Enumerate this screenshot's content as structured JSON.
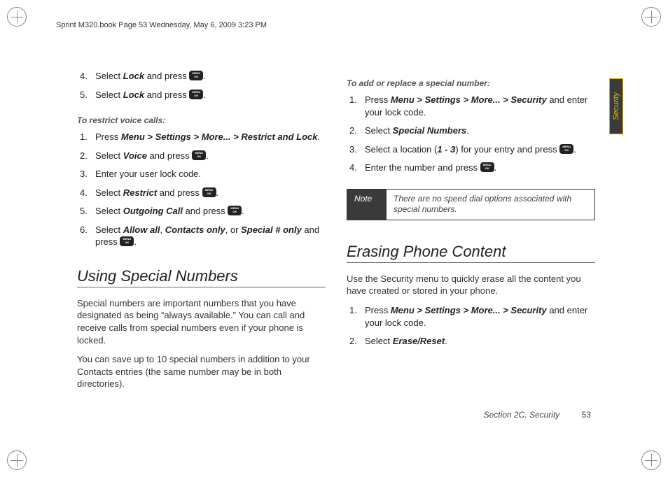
{
  "header": "Sprint M320.book  Page 53  Wednesday, May 6, 2009  3:23 PM",
  "tab_label": "Security",
  "col1": {
    "steps_top": [
      {
        "pre": "Select ",
        "b": "Lock",
        "post": " and press "
      },
      {
        "pre": "Select ",
        "b": "Lock",
        "post": " and press "
      }
    ],
    "sub1": "To restrict voice calls:",
    "steps_restrict": [
      {
        "full_bold_path": true,
        "pre": "Press ",
        "b": "Menu > Settings > More... > Restrict and Lock",
        "post": "."
      },
      {
        "pre": "Select ",
        "b": "Voice",
        "post": " and press "
      },
      {
        "plain": "Enter your user lock code."
      },
      {
        "pre": "Select ",
        "b": "Restrict",
        "post": " and press "
      },
      {
        "pre": "Select ",
        "b": "Outgoing Call",
        "post": " and press "
      },
      {
        "multi": true,
        "pre": "Select ",
        "b1": "Allow all",
        "sep1": ", ",
        "b2": "Contacts only",
        "sep2": ", or ",
        "b3": "Special # only",
        "post": " and press "
      }
    ],
    "h2": "Using Special Numbers",
    "p1": "Special numbers are important numbers that you have designated as being “always available.” You can call and receive calls from special numbers even if your phone is locked.",
    "p2": "You can save up to 10 special numbers in addition to your Contacts entries (the same number may be in both directories)."
  },
  "col2": {
    "sub1": "To add or replace a special number:",
    "steps_add": [
      {
        "pre": "Press ",
        "b": "Menu > Settings > More... > Security",
        "post": " and enter your lock code."
      },
      {
        "pre": "Select ",
        "b": "Special Numbers",
        "post": "."
      },
      {
        "loc": true,
        "pre": "Select a location (",
        "b": "1 - 3",
        "post": ") for your entry and press "
      },
      {
        "pre": "Enter the number and press ",
        "keyonly": true
      }
    ],
    "note_label": "Note",
    "note_text": "There are no speed dial options associated with special numbers.",
    "h2": "Erasing Phone Content",
    "p1": "Use the Security menu to quickly erase all the content you have created or stored in your phone.",
    "steps_erase": [
      {
        "pre": "Press ",
        "b": "Menu > Settings > More... > Security",
        "post": " and enter your lock code."
      },
      {
        "pre": "Select ",
        "b": "Erase/Reset",
        "post": "."
      }
    ]
  },
  "footer_section": "Section 2C. Security",
  "footer_page": "53"
}
